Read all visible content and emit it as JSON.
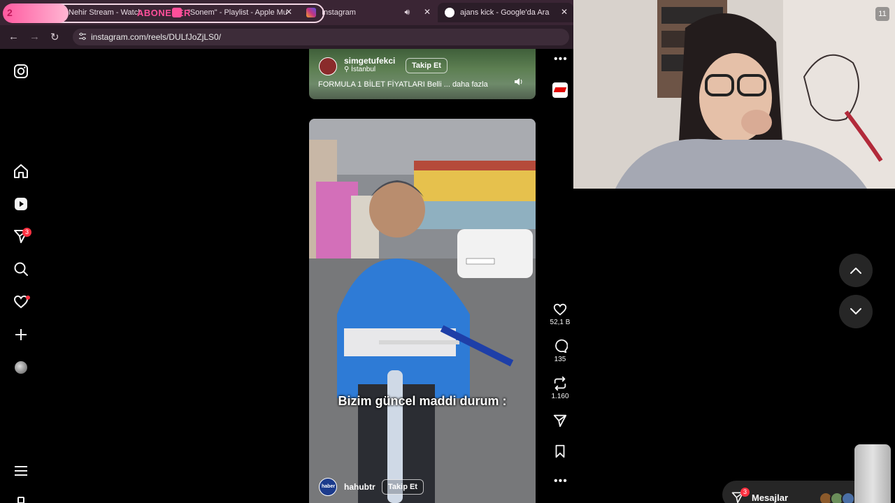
{
  "overlay": {
    "count": "2",
    "abone_text": "ABONELER"
  },
  "tabs": [
    {
      "label": "Nehir Stream - Watch",
      "fav_color": "#ff4f9a"
    },
    {
      "label": "\"Sonem\" - Playlist - Apple Mu",
      "fav_color": "#ff4f9a"
    },
    {
      "label": "Instagram",
      "fav_color": "#c13584"
    },
    {
      "label": "ajans kick - Google'da Ara",
      "fav_color": "#4285f4"
    }
  ],
  "address": {
    "url": "instagram.com/reels/DULfJoZjLS0/"
  },
  "sidebar": {
    "notifications_badge": "3"
  },
  "reel_top": {
    "username": "simgetufekci",
    "location": "İstanbul",
    "follow": "Takip Et",
    "caption": "FORMULA 1 BİLET FİYATLARI Belli ... daha fazla"
  },
  "reel_main": {
    "caption_overlay": "Bizim güncel maddi durum :",
    "username": "hahubtr",
    "follow": "Takip Et",
    "avatar_text": "haber"
  },
  "actions": {
    "likes": "52,1 B",
    "comments": "135",
    "reposts": "1.160"
  },
  "webcam": {
    "count": "11"
  },
  "messages": {
    "label": "Mesajlar",
    "badge": "3"
  }
}
